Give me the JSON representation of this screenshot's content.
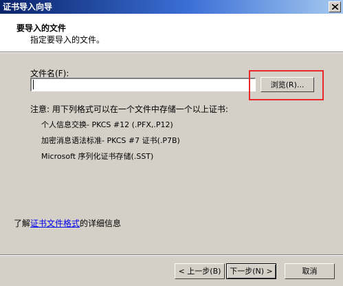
{
  "window": {
    "title": "证书导入向导",
    "close_icon": "close-icon"
  },
  "header": {
    "title": "要导入的文件",
    "subtitle": "指定要导入的文件。"
  },
  "form": {
    "file_label": "文件名(F):",
    "file_value": "",
    "browse_label": "浏览(R)..."
  },
  "note": {
    "text": "注意: 用下列格式可以在一个文件中存储一个以上证书:",
    "formats": [
      "个人信息交换- PKCS #12 (.PFX,.P12)",
      "加密消息语法标准- PKCS #7 证书(.P7B)",
      "Microsoft 序列化证书存储(.SST)"
    ]
  },
  "learn_more": {
    "prefix": "了解",
    "link": "证书文件格式",
    "suffix": "的详细信息"
  },
  "footer": {
    "back_label": "< 上一步(B)",
    "next_label": "下一步(N) >",
    "cancel_label": "取消"
  },
  "colors": {
    "highlight": "#e8282a",
    "link": "#0000ee",
    "titlebar_start": "#0a246a"
  }
}
